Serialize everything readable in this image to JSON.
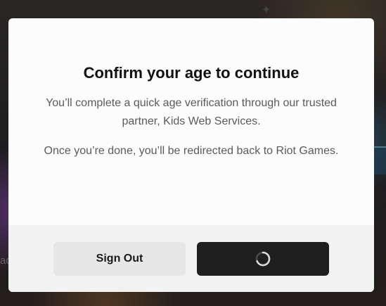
{
  "background": {
    "partial_text_left": "ac"
  },
  "modal": {
    "title": "Confirm your age to continue",
    "paragraph_1": "You’ll complete a quick age verification through our trusted partner, Kids Web Services.",
    "paragraph_2": "Once you’re done, you’ll be redirected back to Riot Games."
  },
  "footer": {
    "sign_out_label": "Sign Out",
    "continue_state": "loading",
    "continue_icon": "loading-spinner-icon"
  },
  "colors": {
    "modal_bg": "#fcfcfc",
    "footer_bg": "#f2f2f2",
    "primary_button": "#1f1f1f",
    "secondary_button": "#e7e7e7",
    "title_text": "#111111",
    "body_text": "#5b5b5b"
  }
}
